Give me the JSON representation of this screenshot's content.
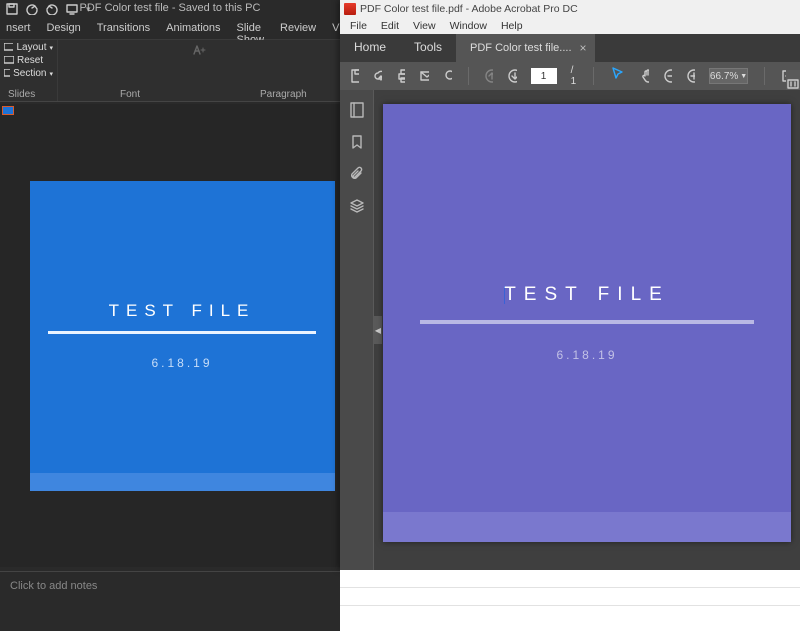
{
  "powerpoint": {
    "window_title": "PDF Color test file - Saved to this PC",
    "tabs": [
      "nsert",
      "Design",
      "Transitions",
      "Animations",
      "Slide Show",
      "Review",
      "View"
    ],
    "slides_group": {
      "layout": "Layout",
      "reset": "Reset",
      "section": "Section"
    },
    "group_labels": {
      "slides": "Slides",
      "font": "Font",
      "paragraph": "Paragraph"
    },
    "slide": {
      "title": "TEST FILE",
      "date": "6.18.19"
    },
    "notes_placeholder": "Click to add notes"
  },
  "acrobat": {
    "window_title": "PDF Color test file.pdf - Adobe Acrobat Pro DC",
    "menubar": [
      "File",
      "Edit",
      "View",
      "Window",
      "Help"
    ],
    "nav_tabs": {
      "home": "Home",
      "tools": "Tools"
    },
    "document_tab": "PDF Color test file....",
    "page_current": "1",
    "page_total": "/ 1",
    "zoom": "66.7%",
    "page": {
      "title": "TEST FILE",
      "date": "6.18.19"
    }
  }
}
